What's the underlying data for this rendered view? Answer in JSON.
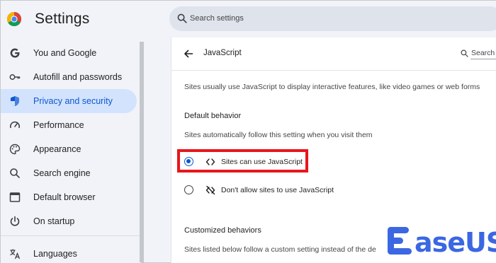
{
  "app": {
    "title": "Settings"
  },
  "header": {
    "search_placeholder": "Search settings"
  },
  "sidebar": {
    "items": [
      {
        "label": "You and Google",
        "icon": "google-g-icon",
        "selected": false
      },
      {
        "label": "Autofill and passwords",
        "icon": "key-icon",
        "selected": false
      },
      {
        "label": "Privacy and security",
        "icon": "shield-icon",
        "selected": true
      },
      {
        "label": "Performance",
        "icon": "speedometer-icon",
        "selected": false
      },
      {
        "label": "Appearance",
        "icon": "palette-icon",
        "selected": false
      },
      {
        "label": "Search engine",
        "icon": "search-icon",
        "selected": false
      },
      {
        "label": "Default browser",
        "icon": "browser-window-icon",
        "selected": false
      },
      {
        "label": "On startup",
        "icon": "power-icon",
        "selected": false
      },
      {
        "label": "Languages",
        "icon": "translate-icon",
        "selected": false
      }
    ]
  },
  "page": {
    "title": "JavaScript",
    "search_label": "Search",
    "description": "Sites usually use JavaScript to display interactive features, like video games or web forms",
    "default_behavior": {
      "heading": "Default behavior",
      "subtext": "Sites automatically follow this setting when you visit them",
      "options": [
        {
          "label": "Sites can use JavaScript",
          "icon": "code-brackets-icon",
          "checked": true
        },
        {
          "label": "Don't allow sites to use JavaScript",
          "icon": "code-off-icon",
          "checked": false
        }
      ]
    },
    "customized_behaviors": {
      "heading": "Customized behaviors",
      "subtext": "Sites listed below follow a custom setting instead of the de"
    }
  },
  "watermark": {
    "brand": "EaseUS",
    "text": "aseUS"
  },
  "colors": {
    "accent": "#0b57d0",
    "selected_bg": "#d3e3fd",
    "highlight": "#e8161d",
    "watermark": "#3b67e3"
  }
}
